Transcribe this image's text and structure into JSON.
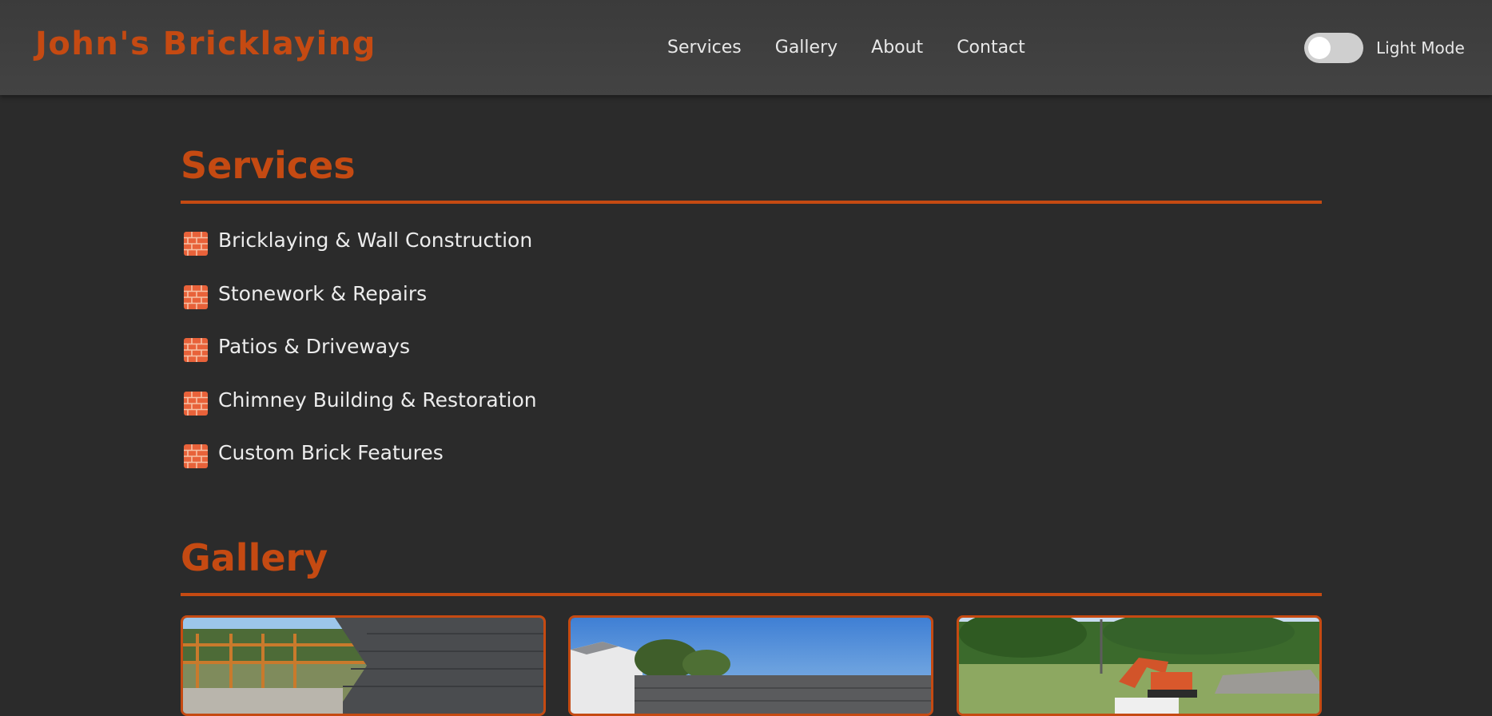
{
  "brand": "John's Bricklaying",
  "nav": {
    "links": [
      "Services",
      "Gallery",
      "About",
      "Contact"
    ]
  },
  "theme_toggle": {
    "label": "Light Mode",
    "on": false
  },
  "services": {
    "title": "Services",
    "icon": "brick-icon",
    "items": [
      "Bricklaying & Wall Construction",
      "Stonework & Repairs",
      "Patios & Driveways",
      "Chimney Building & Restoration",
      "Custom Brick Features"
    ]
  },
  "gallery": {
    "title": "Gallery",
    "photo_count_visible": 3
  },
  "colors": {
    "accent": "#c54a12",
    "background": "#2b2b2b",
    "navbar": "#404040",
    "text": "#ececec"
  }
}
